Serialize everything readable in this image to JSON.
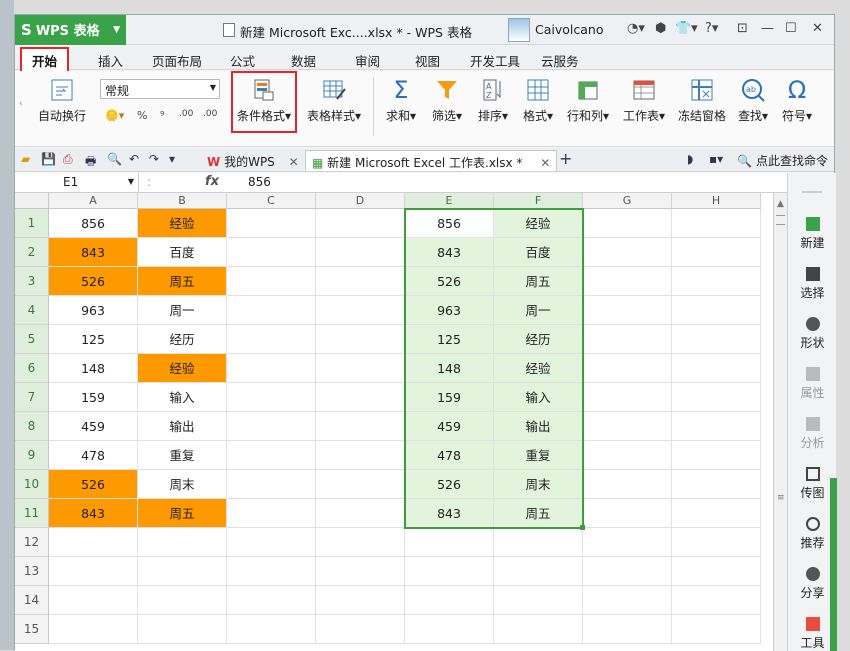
{
  "titlebar": {
    "app": "WPS 表格",
    "doc_title": "新建 Microsoft Exc....xlsx * - WPS 表格",
    "user": "Caivolcano"
  },
  "menu": [
    "开始",
    "插入",
    "页面布局",
    "公式",
    "数据",
    "审阅",
    "视图",
    "开发工具",
    "云服务"
  ],
  "ribbon": {
    "wrap": "自动换行",
    "number_format": "常规",
    "percent": "%",
    "comma": "⁹",
    "inc_decimal": ".00",
    "dec_decimal": ".00",
    "conditional": "条件格式",
    "table_style": "表格样式",
    "sum": "求和",
    "filter": "筛选",
    "sort": "排序",
    "format": "格式",
    "rowcol": "行和列",
    "sheet": "工作表",
    "freeze": "冻结窗格",
    "find": "查找",
    "symbol": "符号"
  },
  "tabs": {
    "mywps": "我的WPS",
    "doc": "新建 Microsoft Excel 工作表.xlsx *",
    "search": "点此查找命令"
  },
  "formula": {
    "namebox": "E1",
    "fx": "fx",
    "value": "856"
  },
  "columns": [
    "A",
    "B",
    "C",
    "D",
    "E",
    "F",
    "G",
    "H"
  ],
  "rows": [
    {
      "n": "1",
      "a": "856",
      "b": "经验",
      "e": "856",
      "f": "经验"
    },
    {
      "n": "2",
      "a": "843",
      "b": "百度",
      "e": "843",
      "f": "百度"
    },
    {
      "n": "3",
      "a": "526",
      "b": "周五",
      "e": "526",
      "f": "周五"
    },
    {
      "n": "4",
      "a": "963",
      "b": "周一",
      "e": "963",
      "f": "周一"
    },
    {
      "n": "5",
      "a": "125",
      "b": "经历",
      "e": "125",
      "f": "经历"
    },
    {
      "n": "6",
      "a": "148",
      "b": "经验",
      "e": "148",
      "f": "经验"
    },
    {
      "n": "7",
      "a": "159",
      "b": "输入",
      "e": "159",
      "f": "输入"
    },
    {
      "n": "8",
      "a": "459",
      "b": "输出",
      "e": "459",
      "f": "输出"
    },
    {
      "n": "9",
      "a": "478",
      "b": "重复",
      "e": "478",
      "f": "重复"
    },
    {
      "n": "10",
      "a": "526",
      "b": "周末",
      "e": "526",
      "f": "周末"
    },
    {
      "n": "11",
      "a": "843",
      "b": "周五",
      "e": "843",
      "f": "周五"
    },
    {
      "n": "12"
    },
    {
      "n": "13"
    },
    {
      "n": "14"
    },
    {
      "n": "15"
    }
  ],
  "highlight": {
    "color": "#ff9900",
    "a_rows": [
      2,
      3,
      10,
      11
    ],
    "b_rows": [
      1,
      3,
      6,
      11
    ]
  },
  "rightpanel": [
    "新建",
    "选择",
    "形状",
    "属性",
    "分析",
    "传图",
    "推荐",
    "分享",
    "工具"
  ]
}
